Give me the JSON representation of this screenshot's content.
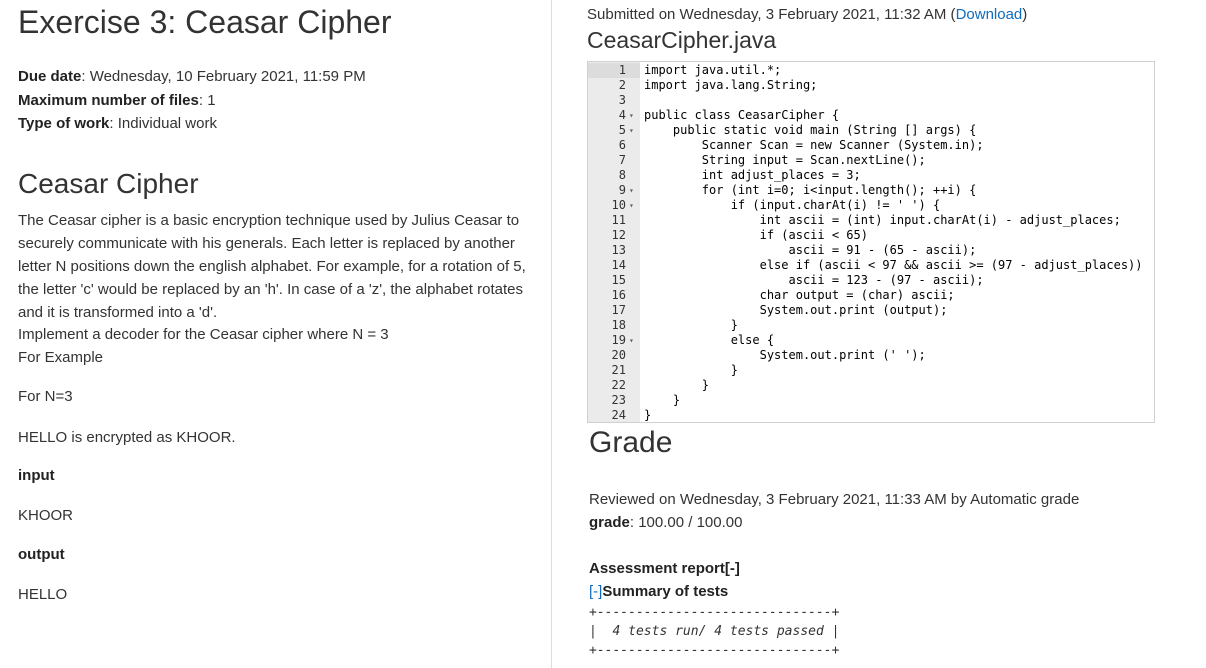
{
  "exercise": {
    "title": "Exercise 3: Ceasar Cipher",
    "due_date": {
      "label": "Due date",
      "value": ": Wednesday, 10 February 2021, 11:59 PM"
    },
    "max_files": {
      "label": "Maximum number of files",
      "value": ": 1"
    },
    "work_type": {
      "label": "Type of work",
      "value": ": Individual work"
    }
  },
  "description": {
    "title": "Ceasar Cipher",
    "paragraph": "The Ceasar cipher is a basic encryption technique used by Julius Ceasar to securely communicate with his generals. Each letter is replaced by another letter N positions down the english alphabet. For example, for a rotation of 5, the letter 'c' would be replaced by an 'h'. In case of a 'z', the alphabet rotates and it is transformed into a 'd'.",
    "implement": "Implement a decoder for the Ceasar cipher where N = 3",
    "for_example": "For Example",
    "for_n": "For N=3",
    "encrypted": "HELLO is encrypted as KHOOR.",
    "input_label": "input",
    "input_value": "KHOOR",
    "output_label": "output",
    "output_value": "HELLO"
  },
  "submission": {
    "submitted_text": "Submitted on Wednesday, 3 February 2021, 11:32 AM (",
    "download_label": "Download",
    "close_paren": ")",
    "file_name": "CeasarCipher.java",
    "code_lines": [
      {
        "n": "1",
        "fold": "",
        "text": "import java.util.*;"
      },
      {
        "n": "2",
        "fold": "",
        "text": "import java.lang.String;"
      },
      {
        "n": "3",
        "fold": "",
        "text": ""
      },
      {
        "n": "4",
        "fold": "▾",
        "text": "public class CeasarCipher {"
      },
      {
        "n": "5",
        "fold": "▾",
        "text": "    public static void main (String [] args) {"
      },
      {
        "n": "6",
        "fold": "",
        "text": "        Scanner Scan = new Scanner (System.in);"
      },
      {
        "n": "7",
        "fold": "",
        "text": "        String input = Scan.nextLine();"
      },
      {
        "n": "8",
        "fold": "",
        "text": "        int adjust_places = 3;"
      },
      {
        "n": "9",
        "fold": "▾",
        "text": "        for (int i=0; i<input.length(); ++i) {"
      },
      {
        "n": "10",
        "fold": "▾",
        "text": "            if (input.charAt(i) != ' ') {"
      },
      {
        "n": "11",
        "fold": "",
        "text": "                int ascii = (int) input.charAt(i) - adjust_places;"
      },
      {
        "n": "12",
        "fold": "",
        "text": "                if (ascii < 65)"
      },
      {
        "n": "13",
        "fold": "",
        "text": "                    ascii = 91 - (65 - ascii);"
      },
      {
        "n": "14",
        "fold": "",
        "text": "                else if (ascii < 97 && ascii >= (97 - adjust_places))"
      },
      {
        "n": "15",
        "fold": "",
        "text": "                    ascii = 123 - (97 - ascii);"
      },
      {
        "n": "16",
        "fold": "",
        "text": "                char output = (char) ascii;"
      },
      {
        "n": "17",
        "fold": "",
        "text": "                System.out.print (output);"
      },
      {
        "n": "18",
        "fold": "",
        "text": "            }"
      },
      {
        "n": "19",
        "fold": "▾",
        "text": "            else {"
      },
      {
        "n": "20",
        "fold": "",
        "text": "                System.out.print (' ');"
      },
      {
        "n": "21",
        "fold": "",
        "text": "            }"
      },
      {
        "n": "22",
        "fold": "",
        "text": "        }"
      },
      {
        "n": "23",
        "fold": "",
        "text": "    }"
      },
      {
        "n": "24",
        "fold": "",
        "text": "}"
      }
    ]
  },
  "grade": {
    "title": "Grade",
    "reviewed": "Reviewed on Wednesday, 3 February 2021, 11:33 AM by Automatic grade",
    "grade_label": "grade",
    "grade_value": ": 100.00 / 100.00",
    "assessment_label": "Assessment report",
    "assessment_toggle": "[-]",
    "summary_toggle": "[-]",
    "summary_label": "Summary of tests",
    "box_top": "+------------------------------+",
    "box_middle": "|  4 tests run/ 4 tests passed |",
    "box_bottom": "+------------------------------+"
  }
}
